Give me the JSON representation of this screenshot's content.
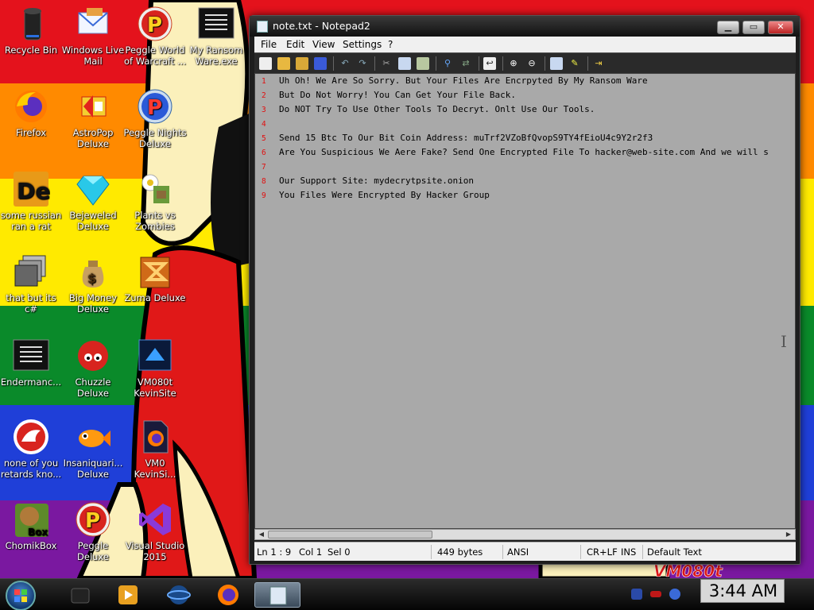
{
  "desktop": {
    "icons": [
      {
        "label": "Recycle Bin",
        "icon": "recycle-bin-icon"
      },
      {
        "label": "Windows Live\nMail",
        "icon": "mail-icon"
      },
      {
        "label": "Peggle World\nof Warcraft ...",
        "icon": "peggle-icon"
      },
      {
        "label": "My Ransom\nWare.exe",
        "icon": "console-app-icon"
      },
      {
        "label": "Firefox",
        "icon": "firefox-icon"
      },
      {
        "label": "AstroPop\nDeluxe",
        "icon": "astropop-icon"
      },
      {
        "label": "Peggle Nights\nDeluxe",
        "icon": "peggle-nights-icon"
      },
      {
        "label": "some russian\nran a rat",
        "icon": "de-app-icon"
      },
      {
        "label": "Bejeweled\nDeluxe",
        "icon": "gem-icon"
      },
      {
        "label": "Plants vs\nZombies",
        "icon": "plant-icon"
      },
      {
        "label": "that but its c#",
        "icon": "windows-stack-icon"
      },
      {
        "label": "Big Money\nDeluxe",
        "icon": "money-bag-icon"
      },
      {
        "label": "Zuma Deluxe",
        "icon": "zuma-icon"
      },
      {
        "label": "Endermanc...",
        "icon": "console-app-icon"
      },
      {
        "label": "Chuzzle\nDeluxe",
        "icon": "chuzzle-icon"
      },
      {
        "label": "VM080t\nKevinSite",
        "icon": "vm-shortcut-icon"
      },
      {
        "label": "none of you\nretards kno...",
        "icon": "red-dino-icon"
      },
      {
        "label": "Insaniquari...\nDeluxe",
        "icon": "goldfish-icon"
      },
      {
        "label": "VM0\nKevinSi...",
        "icon": "firefox-file-icon"
      },
      {
        "label": "ChomikBox",
        "icon": "chomikbox-icon"
      },
      {
        "label": "Peggle Deluxe",
        "icon": "peggle-icon"
      },
      {
        "label": "Visual Studio\n2015",
        "icon": "visual-studio-icon"
      }
    ]
  },
  "window": {
    "title": "note.txt - Notepad2",
    "menu": [
      "File",
      "Edit",
      "View",
      "Settings",
      "?"
    ],
    "lines": [
      {
        "num": "1",
        "text": "Uh Oh! We Are So Sorry. But Your Files Are Encrpyted By My Ransom Ware"
      },
      {
        "num": "2",
        "text": "But Do Not Worry! You Can Get Your File Back."
      },
      {
        "num": "3",
        "text": "Do NOT Try To Use Other Tools To Decryt. Onlt Use Our Tools."
      },
      {
        "num": "4",
        "text": ""
      },
      {
        "num": "5",
        "text": "Send 15 Btc To Our Bit Coin Address: muTrf2VZoBfQvopS9TY4fEioU4c9Y2r2f3"
      },
      {
        "num": "6",
        "text": "Are You Suspicious We Aere Fake? Send One Encrypted File To hacker@web-site.com And we will s"
      },
      {
        "num": "7",
        "text": ""
      },
      {
        "num": "8",
        "text": "Our Support Site: mydecrytpsite.onion"
      },
      {
        "num": "9",
        "text": "You Files Were Encrypted By Hacker Group"
      }
    ],
    "status": {
      "position": "Ln 1 : 9",
      "col": "Col 1",
      "sel": "Sel 0",
      "size": "449 bytes",
      "encoding": "ANSI",
      "line_ending": "CR+LF",
      "mode": "INS",
      "scheme": "Default Text"
    }
  },
  "taskbar": {
    "clock": "3:44 AM"
  },
  "colors": {
    "line_number": "#e01010",
    "editor_bg": "#a9a9a9"
  }
}
